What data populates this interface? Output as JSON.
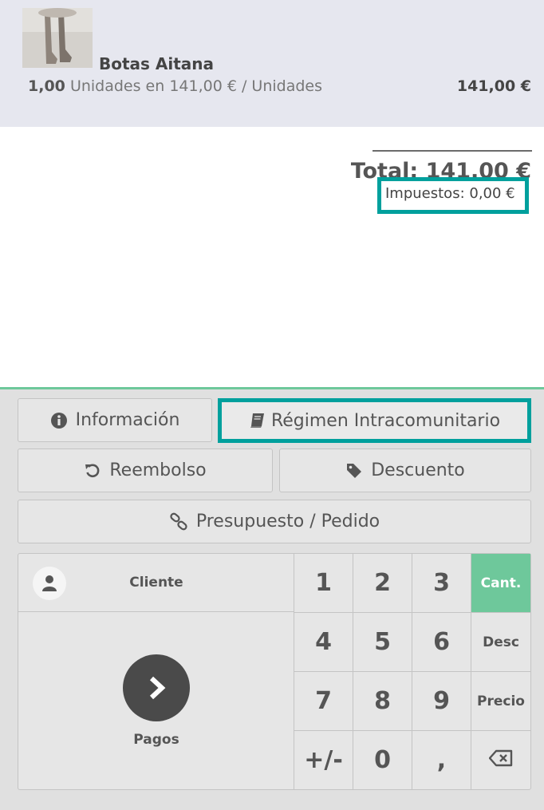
{
  "order": {
    "line": {
      "product_name": "Botas Aitana",
      "quantity": "1,00",
      "unit_detail": "Unidades en 141,00 € / Unidades",
      "price": "141,00 €"
    },
    "total": "Total: 141,00 €",
    "taxes": "Impuestos: 0,00 €"
  },
  "controls": {
    "info_label": "Información",
    "fiscal_label": "Régimen Intracomunitario",
    "refund_label": "Reembolso",
    "discount_label": "Descuento",
    "quotation_label": "Presupuesto / Pedido"
  },
  "numpad": {
    "customer_label": "Cliente",
    "payment_label": "Pagos",
    "keys": [
      "1",
      "2",
      "3",
      "4",
      "5",
      "6",
      "7",
      "8",
      "9",
      "+/-",
      "0",
      ","
    ],
    "modes": [
      "Cant.",
      "Desc",
      "Precio"
    ],
    "active_mode": "Cant."
  },
  "colors": {
    "accent": "#00a09d",
    "active_mode": "#6ec89b",
    "order_bg": "#e6e7ef",
    "controls_bg": "#e0e0e0"
  },
  "icons": {
    "info": "info-circle-icon",
    "fiscal": "book-icon",
    "refund": "undo-icon",
    "discount": "tag-icon",
    "quotation": "link-icon",
    "customer": "user-icon",
    "payment": "chevron-right-icon",
    "backspace": "backspace-icon"
  }
}
